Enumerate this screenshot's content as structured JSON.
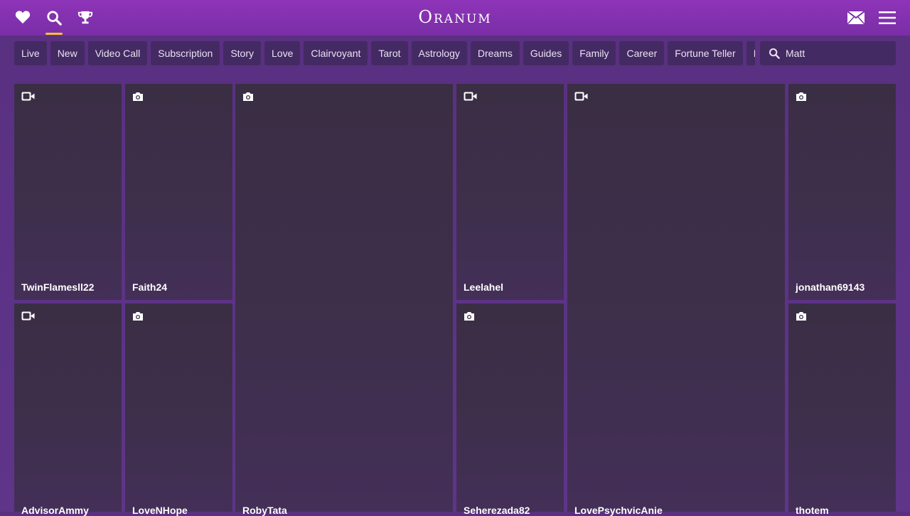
{
  "header": {
    "logo": "Oranum",
    "icons": [
      "heart-icon",
      "search-icon",
      "trophy-icon",
      "mail-icon",
      "hamburger-menu-icon"
    ],
    "accent_color": "#f2c230"
  },
  "filters": [
    "Live",
    "New",
    "Video Call",
    "Subscription",
    "Story",
    "Love",
    "Clairvoyant",
    "Tarot",
    "Astrology",
    "Dreams",
    "Guides",
    "Family",
    "Career",
    "Fortune Teller",
    "I"
  ],
  "search": {
    "value": "Matt",
    "icon": "search-icon"
  },
  "tiles": [
    {
      "name": "TwinFlamesll22",
      "media": "video-camera-icon"
    },
    {
      "name": "Faith24",
      "media": "photo-camera-icon"
    },
    {
      "name": "RobyTata",
      "media": "photo-camera-icon"
    },
    {
      "name": "Leelahel",
      "media": "video-camera-icon"
    },
    {
      "name": "LovePsychvicAnie",
      "media": "video-camera-icon"
    },
    {
      "name": "jonathan69143",
      "media": "photo-camera-icon"
    },
    {
      "name": "AdvisorAmmy",
      "media": "video-camera-icon"
    },
    {
      "name": "LoveNHope",
      "media": "photo-camera-icon"
    },
    {
      "name": "Seherezada82",
      "media": "photo-camera-icon"
    },
    {
      "name": "thotem",
      "media": "photo-camera-icon"
    }
  ]
}
